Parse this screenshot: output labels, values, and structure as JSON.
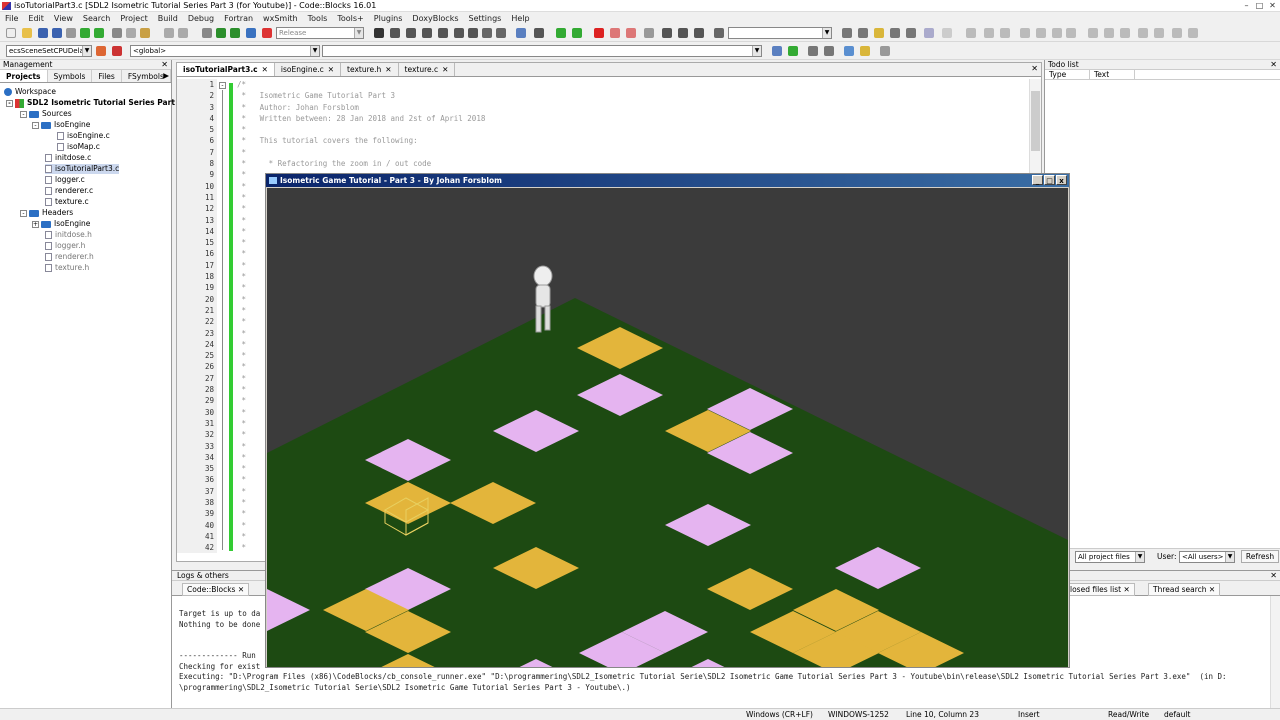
{
  "window": {
    "title": "isoTutorialPart3.c [SDL2 Isometric Tutorial Series Part 3 (for Youtube)] - Code::Blocks 16.01"
  },
  "menu": [
    "File",
    "Edit",
    "View",
    "Search",
    "Project",
    "Build",
    "Debug",
    "Fortran",
    "wxSmith",
    "Tools",
    "Tools+",
    "Plugins",
    "DoxyBlocks",
    "Settings",
    "Help"
  ],
  "toolbar": {
    "build_target": "Release",
    "scope_combo": "ecsSceneSetCPUDelay",
    "symbol_combo": "<global>"
  },
  "management": {
    "title": "Management",
    "tabs": [
      "Projects",
      "Symbols",
      "Files",
      "FSymbols"
    ],
    "tree": [
      {
        "label": "Workspace",
        "type": "workspace"
      },
      {
        "label": "SDL2 Isometric Tutorial Series Part 3",
        "type": "project"
      },
      {
        "label": "Sources",
        "type": "folder"
      },
      {
        "label": "IsoEngine",
        "type": "folder"
      },
      {
        "label": "isoEngine.c",
        "type": "file"
      },
      {
        "label": "isoMap.c",
        "type": "file"
      },
      {
        "label": "initdose.c",
        "type": "file"
      },
      {
        "label": "isoTutorialPart3.c",
        "type": "file"
      },
      {
        "label": "logger.c",
        "type": "file"
      },
      {
        "label": "renderer.c",
        "type": "file"
      },
      {
        "label": "texture.c",
        "type": "file"
      },
      {
        "label": "Headers",
        "type": "folder"
      },
      {
        "label": "IsoEngine",
        "type": "folder"
      },
      {
        "label": "initdose.h",
        "type": "file"
      },
      {
        "label": "logger.h",
        "type": "file"
      },
      {
        "label": "renderer.h",
        "type": "file"
      },
      {
        "label": "texture.h",
        "type": "file"
      }
    ]
  },
  "editor": {
    "tabs": [
      "isoTutorialPart3.c",
      "isoEngine.c",
      "texture.h",
      "texture.c"
    ],
    "line_numbers": [
      "1",
      "2",
      "3",
      "4",
      "5",
      "6",
      "7",
      "8",
      "9",
      "10",
      "11",
      "12",
      "13",
      "14",
      "15",
      "16",
      "17",
      "18",
      "19",
      "20",
      "21",
      "22",
      "23",
      "24",
      "25",
      "26",
      "27",
      "28",
      "29",
      "30",
      "31",
      "32",
      "33",
      "34",
      "35",
      "36",
      "37",
      "38",
      "39",
      "40",
      "41",
      "42"
    ],
    "code_lines": [
      "/*",
      " *   Isometric Game Tutorial Part 3",
      " *   Author: Johan Forsblom",
      " *   Written between: 28 Jan 2018 and 2st of April 2018",
      " *",
      " *   This tutorial covers the following:",
      " *",
      " *     * Refactoring the zoom in / out code",
      " *",
      " *"
    ],
    "gutter_star": " *"
  },
  "todo": {
    "title": "Todo list",
    "columns": [
      "Type",
      "Text"
    ],
    "scope": "All project files",
    "user_label": "User:",
    "user_value": "<All users>",
    "refresh": "Refresh"
  },
  "logs": {
    "title": "Logs & others",
    "tabs": [
      "Code::Blocks",
      "losed files list",
      "Thread search"
    ],
    "lines": [
      "Target is up to da",
      "Nothing to be done",
      "",
      "",
      "------------- Run",
      "Checking for exist",
      "Executing: \"D:\\Program Files (x86)\\CodeBlocks/cb_console_runner.exe\" \"D:\\programmering\\SDL2_Isometric Tutorial Serie\\SDL2 Isometric Game Tutorial Series Part 3 - Youtube\\bin\\release\\SDL2 Isometric Tutorial Series Part 3.exe\"  (in D:",
      "\\programmering\\SDL2_Isometric Tutorial Serie\\SDL2 Isometric Game Tutorial Series Part 3 - Youtube\\.)"
    ]
  },
  "status": {
    "line_endings": "Windows (CR+LF)",
    "encoding": "WINDOWS-1252",
    "position": "Line 10, Column 23",
    "mode": "Insert",
    "access": "Read/Write",
    "profile": "default"
  },
  "game_window": {
    "title": "Isometric Game Tutorial - Part 3 - By Johan Forsblom",
    "colors": {
      "background": "#3b3b3b",
      "grass": "#1d4a12",
      "sand": "#e3b53b",
      "pink": "#e5b4f0",
      "cursor": "#e8d060"
    }
  }
}
